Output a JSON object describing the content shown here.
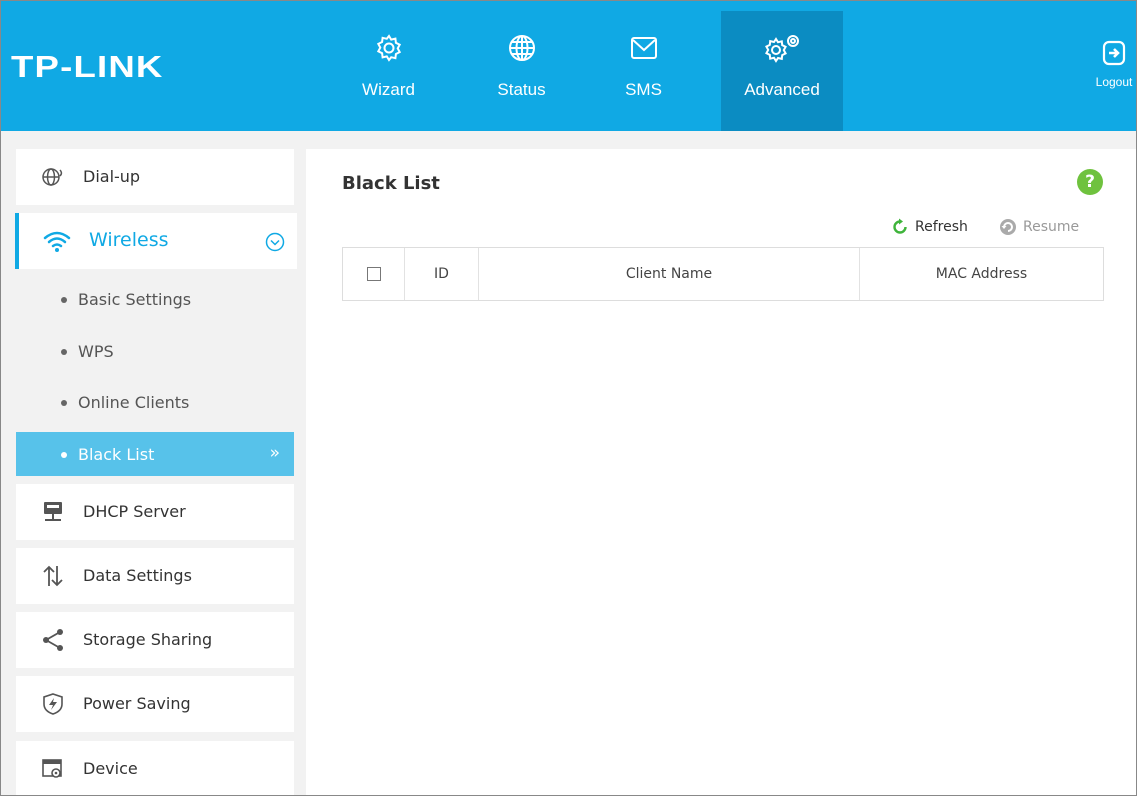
{
  "header": {
    "logo": "TP-LINK",
    "nav": [
      {
        "label": "Wizard",
        "icon": "gear-icon"
      },
      {
        "label": "Status",
        "icon": "globe-icon"
      },
      {
        "label": "SMS",
        "icon": "envelope-icon"
      },
      {
        "label": "Advanced",
        "icon": "gears-icon",
        "active": true
      }
    ],
    "logout_label": "Logout"
  },
  "sidebar": {
    "items": [
      {
        "label": "Dial-up",
        "icon": "globe-phone-icon"
      },
      {
        "label": "Wireless",
        "icon": "wifi-icon",
        "expanded": true,
        "subitems": [
          {
            "label": "Basic Settings"
          },
          {
            "label": "WPS"
          },
          {
            "label": "Online Clients"
          },
          {
            "label": "Black List",
            "active": true
          }
        ]
      },
      {
        "label": "DHCP Server",
        "icon": "server-icon"
      },
      {
        "label": "Data Settings",
        "icon": "up-down-arrows-icon"
      },
      {
        "label": "Storage Sharing",
        "icon": "share-icon"
      },
      {
        "label": "Power Saving",
        "icon": "power-icon"
      },
      {
        "label": "Device",
        "icon": "device-icon"
      }
    ]
  },
  "main": {
    "title": "Black List",
    "help_label": "?",
    "toolbar": {
      "refresh_label": "Refresh",
      "resume_label": "Resume"
    },
    "table": {
      "columns": [
        "ID",
        "Client Name",
        "MAC Address"
      ],
      "rows": []
    }
  },
  "colors": {
    "brand": "#10a9e4",
    "active_nav": "#0b8cc2",
    "active_sub": "#57c2ea",
    "help": "#6fc23e"
  }
}
